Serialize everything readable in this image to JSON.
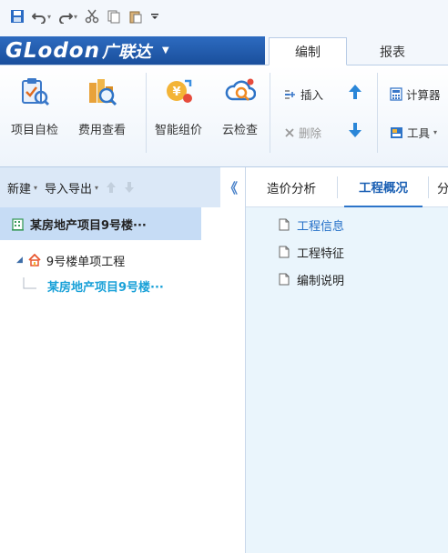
{
  "quick_access": {
    "items": [
      {
        "name": "save-icon"
      },
      {
        "name": "undo-icon",
        "dropdown": true
      },
      {
        "name": "redo-icon",
        "dropdown": true
      },
      {
        "name": "cut-icon"
      },
      {
        "name": "copy-icon"
      },
      {
        "name": "paste-icon"
      },
      {
        "name": "customize-arrow-icon"
      }
    ]
  },
  "brand": {
    "logo": "GLodon",
    "name_cn": "广联达",
    "caret": "▼"
  },
  "tabs": [
    {
      "label": "编制",
      "active": true
    },
    {
      "label": "报表",
      "active": false
    }
  ],
  "ribbon": {
    "buttons": [
      {
        "label": "项目自检",
        "icon": "project-check-icon"
      },
      {
        "label": "费用查看",
        "icon": "cost-view-icon"
      },
      {
        "label": "智能组价",
        "icon": "smart-pricing-icon"
      },
      {
        "label": "云检查",
        "icon": "cloud-check-icon"
      }
    ],
    "small": {
      "insert": "插入",
      "delete": "删除",
      "calculator": "计算器",
      "tools": "工具"
    }
  },
  "left_toolbar": {
    "new": "新建",
    "import_export": "导入导出",
    "collapse": "《"
  },
  "tree": {
    "root": "某房地产项目9号楼···",
    "sub": "9号楼单项工程",
    "leaf": "某房地产项目9号楼···"
  },
  "right_tabs": [
    {
      "label": "造价分析",
      "active": false
    },
    {
      "label": "工程概况",
      "active": true
    },
    {
      "label": "分",
      "active": false
    }
  ],
  "doc_items": [
    {
      "label": "工程信息",
      "selected": true
    },
    {
      "label": "工程特征",
      "selected": false
    },
    {
      "label": "编制说明",
      "selected": false
    }
  ],
  "colors": {
    "brand_bg": "#1f5aa8",
    "selected_text": "#2570c8",
    "leaf_text": "#1aa1d8",
    "right_bg": "#eaf5fc"
  }
}
